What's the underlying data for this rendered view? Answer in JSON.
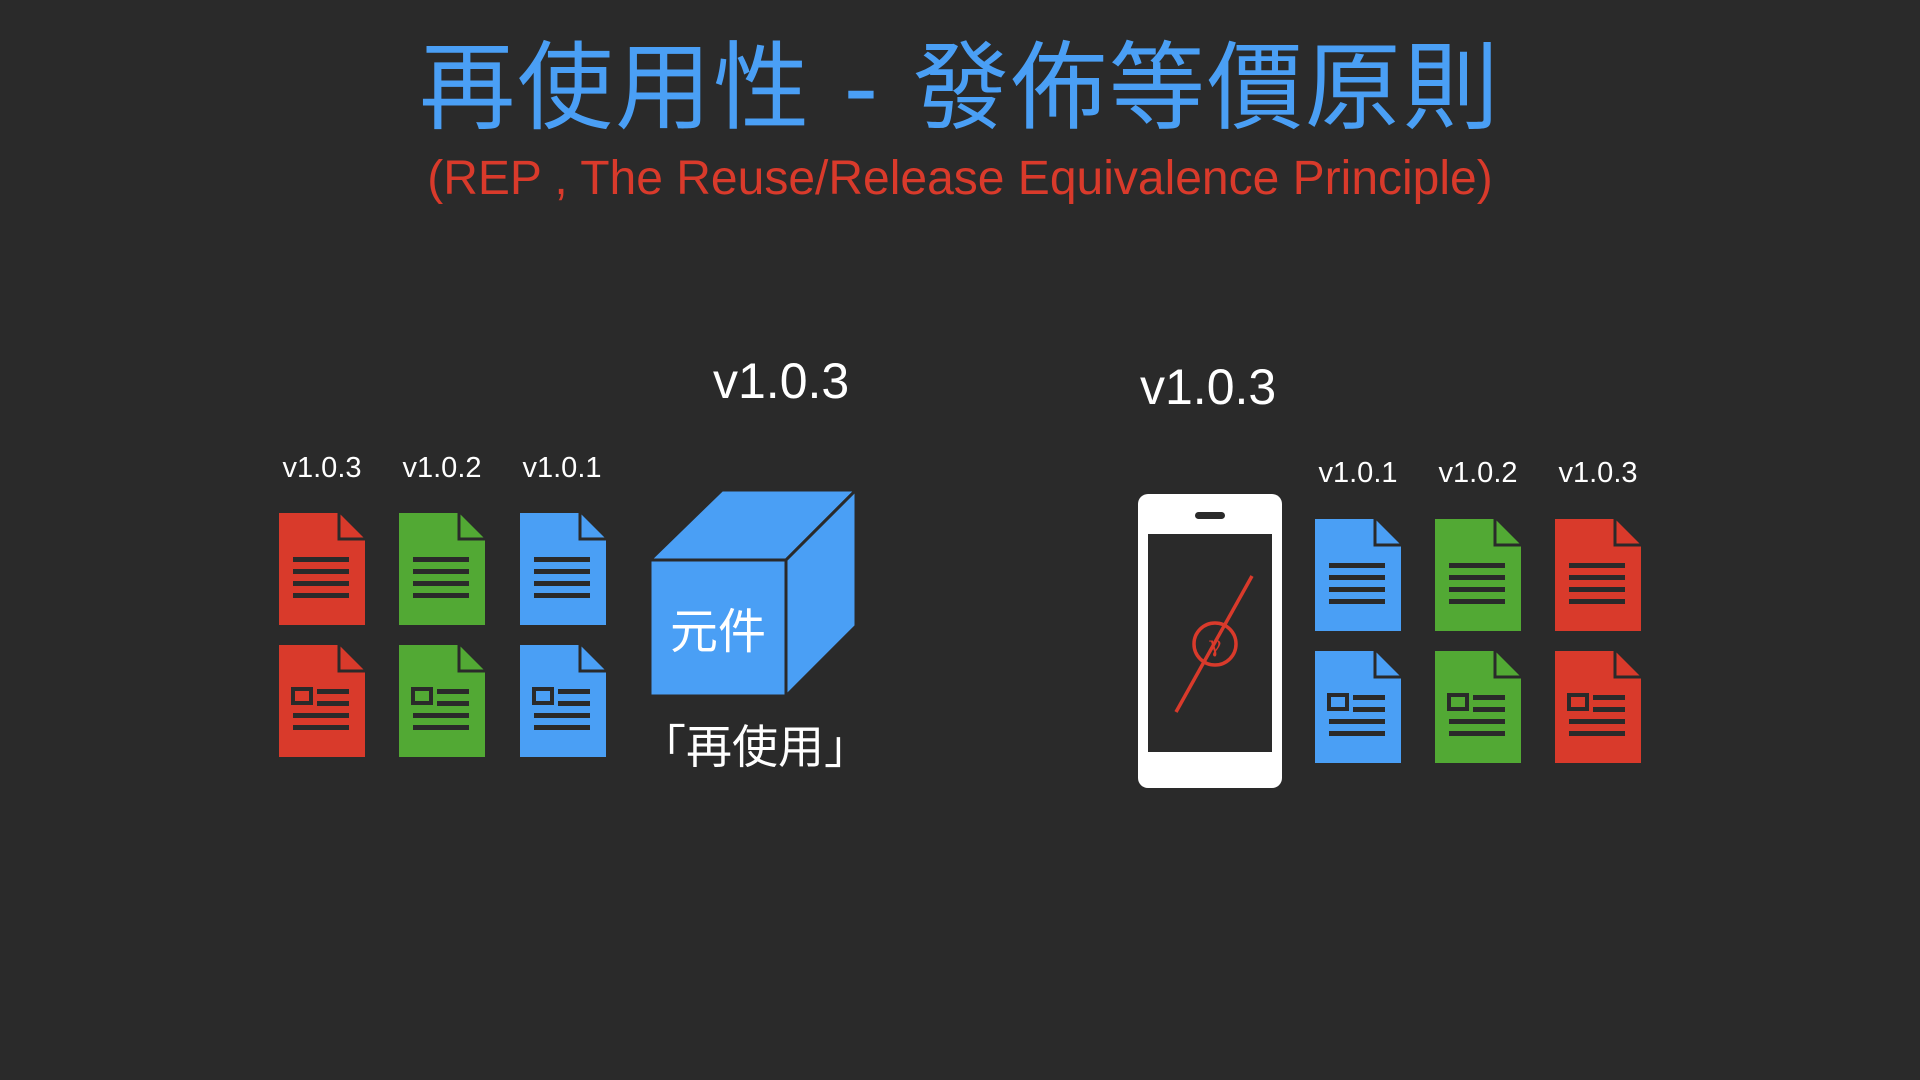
{
  "title": "再使用性 - 發佈等價原則",
  "subtitle": "(REP , The Reuse/Release Equivalence Principle)",
  "left": {
    "release_version": "v1.0.3",
    "columns": [
      {
        "version": "v1.0.3",
        "color": "#d93a2b"
      },
      {
        "version": "v1.0.2",
        "color": "#52a934"
      },
      {
        "version": "v1.0.1",
        "color": "#4a9ff5"
      }
    ],
    "component_label": "元件",
    "reuse_label": "「再使用」",
    "cube_color": "#4a9ff5"
  },
  "right": {
    "release_version": "v1.0.3",
    "columns": [
      {
        "version": "v1.0.1",
        "color": "#4a9ff5"
      },
      {
        "version": "v1.0.2",
        "color": "#52a934"
      },
      {
        "version": "v1.0.3",
        "color": "#d93a2b"
      }
    ],
    "device_icon": "smartphone-icon",
    "app_icon": "app-logo-icon"
  },
  "colors": {
    "background": "#2a2a2a",
    "title": "#4a9ff5",
    "subtitle": "#d93a2b"
  }
}
